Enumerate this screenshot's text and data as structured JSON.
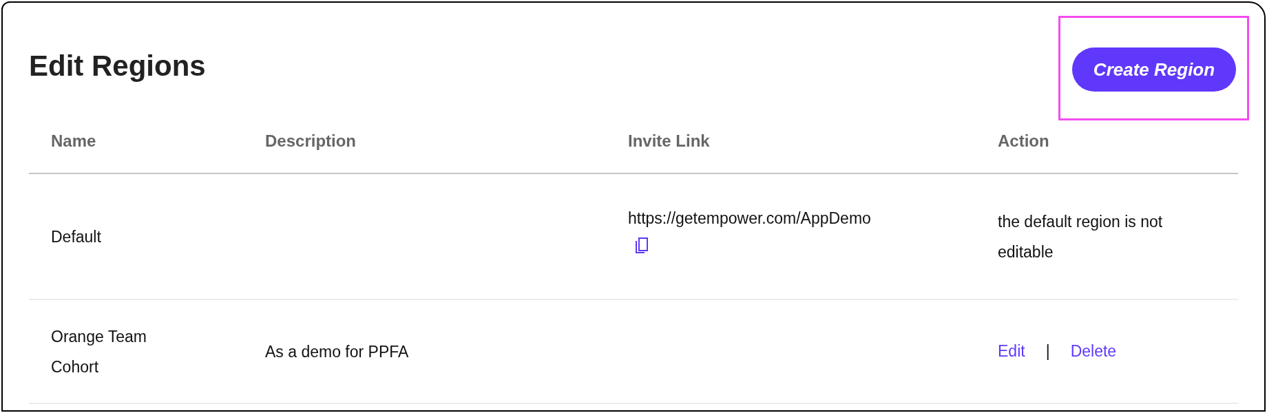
{
  "title": "Edit Regions",
  "create_button": {
    "label": "Create Region",
    "highlighted": true
  },
  "columns": [
    "Name",
    "Description",
    "Invite Link",
    "Action"
  ],
  "rows": [
    {
      "name": "Default",
      "invite_link": "https://getempower.com/AppDemo",
      "action": {
        "kind": "note",
        "text": "the default region is not editable"
      }
    },
    {
      "name": "Orange Team Cohort",
      "description": "As a demo for PPFA",
      "action": {
        "kind": "links",
        "links": [
          "Edit",
          "Delete"
        ],
        "separator": "|"
      }
    }
  ]
}
